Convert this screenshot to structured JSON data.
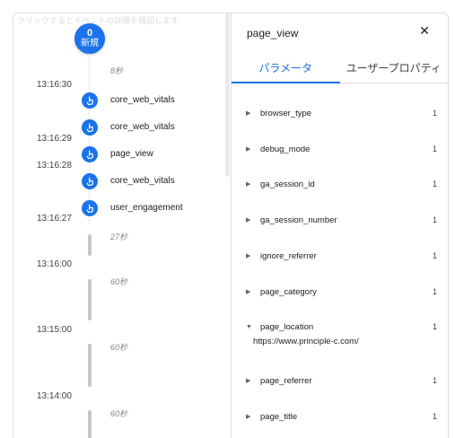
{
  "timeline": {
    "hint": "クリックするとイベントの詳細を確認します",
    "new_badge": {
      "count": "0",
      "label": "新規"
    },
    "gaps": [
      "8秒",
      "27秒",
      "60秒",
      "60秒",
      "60秒"
    ],
    "times": [
      "13:16:30",
      "13:16:29",
      "13:16:28",
      "13:16:27",
      "13:16:00",
      "13:15:00",
      "13:14:00"
    ],
    "events": [
      "core_web_vitals",
      "core_web_vitals",
      "page_view",
      "core_web_vitals",
      "user_engagement"
    ]
  },
  "panel": {
    "title": "page_view",
    "close_icon": "close-icon",
    "tabs": [
      "パラメータ",
      "ユーザープロパティ"
    ],
    "active_tab": "パラメータ",
    "params": [
      {
        "name": "browser_type",
        "count": "1",
        "expanded": false
      },
      {
        "name": "debug_mode",
        "count": "1",
        "expanded": false
      },
      {
        "name": "ga_session_id",
        "count": "1",
        "expanded": false
      },
      {
        "name": "ga_session_number",
        "count": "1",
        "expanded": false
      },
      {
        "name": "ignore_referrer",
        "count": "1",
        "expanded": false
      },
      {
        "name": "page_category",
        "count": "1",
        "expanded": false
      },
      {
        "name": "page_location",
        "count": "1",
        "expanded": true,
        "value": "https://www.principle-c.com/"
      },
      {
        "name": "page_referrer",
        "count": "1",
        "expanded": false
      },
      {
        "name": "page_title",
        "count": "1",
        "expanded": false
      }
    ]
  },
  "colors": {
    "accent": "#1a73e8",
    "border": "#dadce0",
    "gap_segment": "#c4c7cb"
  }
}
